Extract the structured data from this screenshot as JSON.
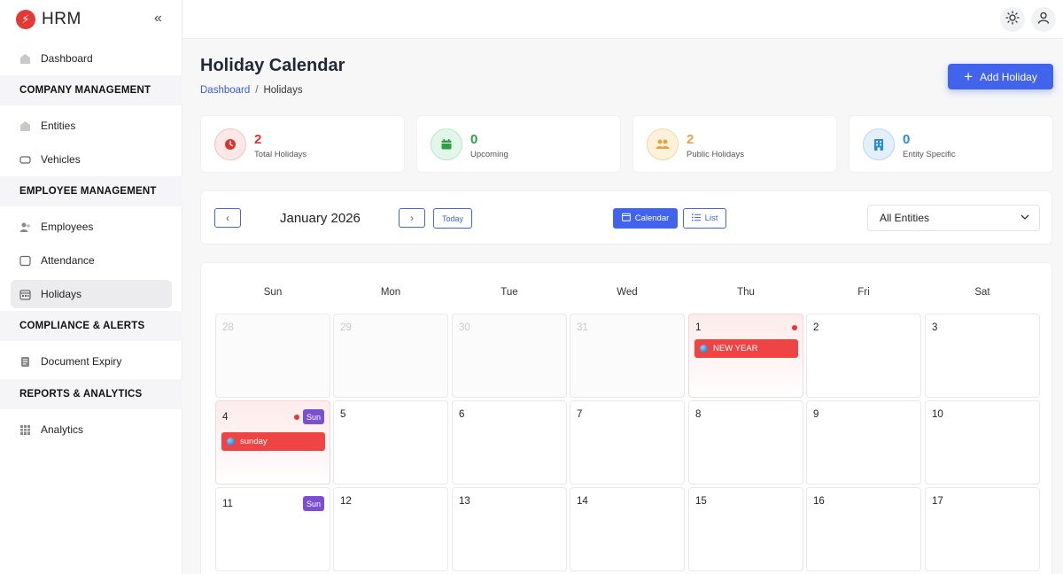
{
  "brand": {
    "logo_glyph": "⚡",
    "name": "HRM",
    "collapse_glyph": "«"
  },
  "sidebar": {
    "dashboard": "Dashboard",
    "company_section": "COMPANY MANAGEMENT",
    "entities": "Entities",
    "vehicles": "Vehicles",
    "employee_section": "EMPLOYEE MANAGEMENT",
    "employees": "Employees",
    "attendance": "Attendance",
    "holidays": "Holidays",
    "compliance_section": "COMPLIANCE & ALERTS",
    "document_expiry": "Document Expiry",
    "reports_section": "REPORTS & ANALYTICS",
    "analytics": "Analytics"
  },
  "page": {
    "title": "Holiday Calendar",
    "breadcrumb_link": "Dashboard",
    "breadcrumb_sep": "/",
    "breadcrumb_current": "Holidays",
    "add_button": "Add Holiday",
    "add_button_icon": "+"
  },
  "stats": [
    {
      "value": "2",
      "label": "Total Holidays",
      "color": "#e03131",
      "bg": "#fde8e8"
    },
    {
      "value": "0",
      "label": "Upcoming",
      "color": "#2f9e44",
      "bg": "#e3f6ea"
    },
    {
      "value": "2",
      "label": "Public Holidays",
      "color": "#e8a33d",
      "bg": "#fdf1dc"
    },
    {
      "value": "0",
      "label": "Entity Specific",
      "color": "#228be6",
      "bg": "#e3f0fc"
    }
  ],
  "toolbar": {
    "prev": "‹",
    "next": "›",
    "month": "January 2026",
    "today": "Today",
    "calendar_view": "Calendar",
    "list_view": "List",
    "entity_select": "All Entities",
    "select_chevron": "⌄"
  },
  "calendar": {
    "weekdays": [
      "Sun",
      "Mon",
      "Tue",
      "Wed",
      "Thu",
      "Fri",
      "Sat"
    ],
    "weeks": [
      [
        "28",
        "29",
        "30",
        "31",
        "1",
        "2",
        "3"
      ],
      [
        "4",
        "5",
        "6",
        "7",
        "8",
        "9",
        "10"
      ],
      [
        "11",
        "12",
        "13",
        "14",
        "15",
        "16",
        "17"
      ]
    ],
    "sun_badge": "Sun",
    "events": {
      "new_year": "NEW YEAR",
      "sunday": "sunday"
    }
  },
  "colors": {
    "accent": "#4263eb",
    "holiday": "#ef4444",
    "sunday_badge": "#7b4fd0"
  }
}
